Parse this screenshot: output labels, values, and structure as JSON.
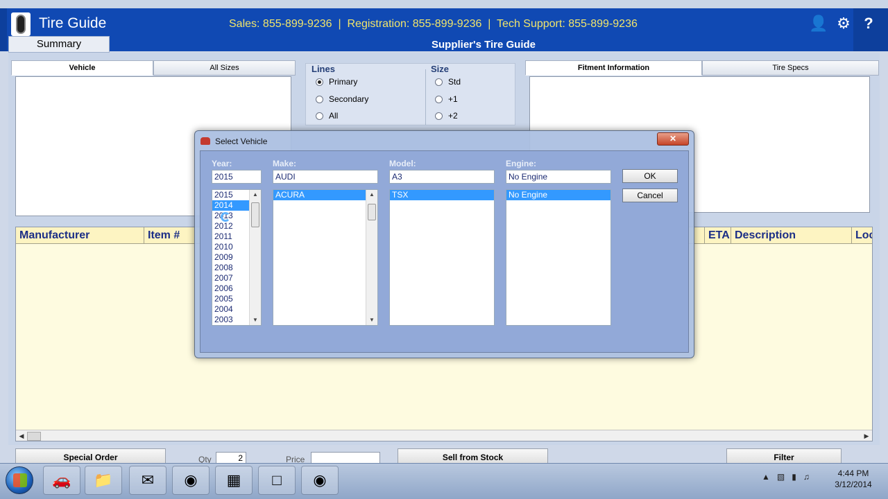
{
  "header": {
    "app_title": "Tire Guide",
    "contact_line": "Sales: 855-899-9236  |  Registration: 855-899-9236  |  Tech Support: 855-899-9236",
    "icons": [
      "user-settings-icon",
      "gear-icon",
      "help-icon"
    ],
    "summary_tab": "Summary",
    "page_subtitle": "Supplier's Tire Guide"
  },
  "left_panel": {
    "tabs": [
      "Vehicle",
      "All Sizes"
    ],
    "active_tab": "Vehicle"
  },
  "options": {
    "lines_title": "Lines",
    "lines": [
      "Primary",
      "Secondary",
      "All"
    ],
    "lines_selected": "Primary",
    "size_title": "Size",
    "sizes": [
      "Std",
      "+1",
      "+2"
    ],
    "size_selected": ""
  },
  "right_panel": {
    "tabs": [
      "Fitment Information",
      "Tire Specs"
    ],
    "active_tab": "Fitment Information"
  },
  "results": {
    "columns": [
      "Manufacturer",
      "Item #",
      "ETA",
      "Description",
      "Loc"
    ]
  },
  "bottom_bar": {
    "special_order": "Special Order",
    "qty_label": "Qty",
    "qty_value": "2",
    "price_label": "Price",
    "price_value": "",
    "sell_from_stock": "Sell from Stock",
    "filter": "Filter"
  },
  "dialog": {
    "title": "Select Vehicle",
    "close_label": "✕",
    "year_label": "Year:",
    "year_value": "2015",
    "make_label": "Make:",
    "make_value": "AUDI",
    "model_label": "Model:",
    "model_value": "A3",
    "engine_label": "Engine:",
    "engine_value": "No Engine",
    "years": [
      "2015",
      "2014",
      "2013",
      "2012",
      "2011",
      "2010",
      "2009",
      "2008",
      "2007",
      "2006",
      "2005",
      "2004",
      "2003"
    ],
    "year_selected": "2014",
    "makes": [
      "ACURA"
    ],
    "make_selected": "ACURA",
    "models": [
      "TSX"
    ],
    "model_selected": "TSX",
    "engines": [
      "No Engine"
    ],
    "engine_selected": "No Engine",
    "ok_label": "OK",
    "cancel_label": "Cancel"
  },
  "taskbar": {
    "items": [
      "app-launcher-icon",
      "file-explorer-icon",
      "outlook-icon",
      "chrome-icon",
      "tire-guide-icon",
      "window-icon",
      "tire-guide-alt-icon"
    ],
    "clock_time": "4:44 PM",
    "clock_date": "3/12/2014"
  },
  "colors": {
    "header_blue": "#1049b3",
    "contact_yellow": "#f1e56b",
    "column_head_blue": "#1b2e86",
    "selection_blue": "#3399ff"
  }
}
